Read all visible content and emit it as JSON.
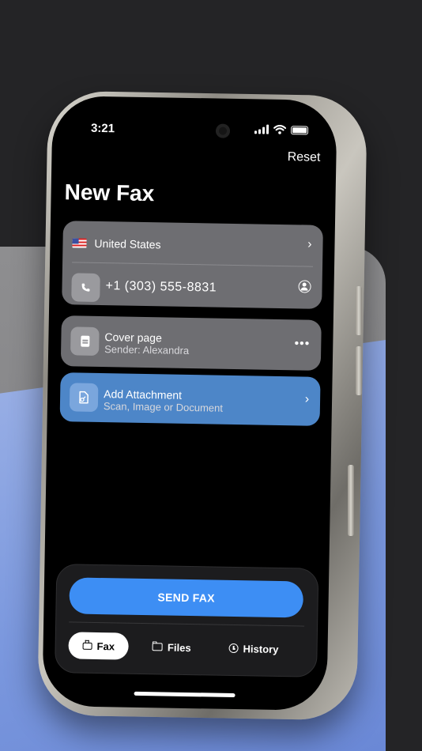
{
  "status_bar": {
    "time": "3:21"
  },
  "header": {
    "reset_label": "Reset",
    "title": "New Fax"
  },
  "recipient": {
    "country": "United States",
    "phone_number": "+1 (303) 555-8831"
  },
  "cover_page": {
    "title": "Cover page",
    "subtitle": "Sender: Alexandra",
    "menu_glyph": "•••"
  },
  "attachment": {
    "title": "Add Attachment",
    "subtitle": "Scan, Image or Document"
  },
  "actions": {
    "send_label": "SEND FAX"
  },
  "tabs": [
    {
      "label": "Fax",
      "icon": "fax-icon",
      "active": true
    },
    {
      "label": "Files",
      "icon": "folder-icon",
      "active": false
    },
    {
      "label": "History",
      "icon": "clock-icon",
      "active": false
    }
  ],
  "colors": {
    "accent": "#3d8ef4",
    "attachment_card": "#4d86c8",
    "card": "#6e6e72",
    "background": "#242426"
  }
}
